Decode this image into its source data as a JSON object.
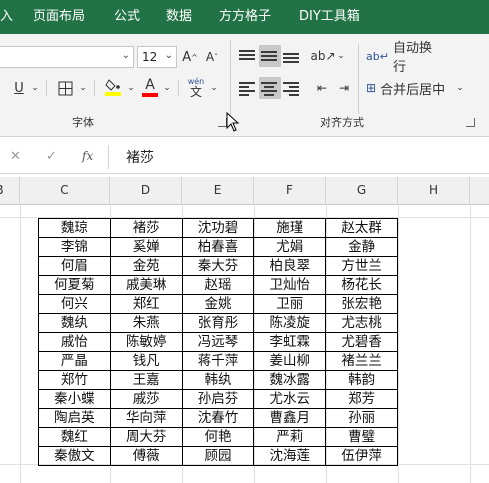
{
  "menu": {
    "tabs": [
      "入",
      "页面布局",
      "公式",
      "数据",
      "方方格子",
      "DIY工具箱"
    ]
  },
  "ribbon": {
    "font_size": "12",
    "font_group_label": "字体",
    "align_group_label": "对齐方式",
    "wrap_text_label": "自动换行",
    "merge_center_label": "合并后居中",
    "phonetic_top": "wén",
    "phonetic_bottom": "文"
  },
  "formula_bar": {
    "cancel_symbol": "✕",
    "enter_symbol": "✓",
    "fx_label": "fx",
    "content": "褚莎"
  },
  "columns": [
    "B",
    "C",
    "D",
    "E",
    "F",
    "G",
    "H"
  ],
  "table": {
    "rows": [
      [
        "魏琼",
        "褚莎",
        "沈功碧",
        "施瑾",
        "赵太群"
      ],
      [
        "李锦",
        "奚婵",
        "柏春喜",
        "尤娟",
        "金静"
      ],
      [
        "何眉",
        "金苑",
        "秦大芬",
        "柏良翠",
        "方世兰"
      ],
      [
        "何夏菊",
        "戚美琳",
        "赵瑶",
        "卫灿怡",
        "杨花长"
      ],
      [
        "何兴",
        "郑红",
        "金姚",
        "卫丽",
        "张宏艳"
      ],
      [
        "魏纨",
        "朱燕",
        "张育彤",
        "陈凌旋",
        "尤志桃"
      ],
      [
        "戚怡",
        "陈敏婷",
        "冯远琴",
        "李虹霖",
        "尤碧香"
      ],
      [
        "严晶",
        "钱凡",
        "蒋千萍",
        "姜山柳",
        "褚兰兰"
      ],
      [
        "郑竹",
        "王嘉",
        "韩纨",
        "魏冰露",
        "韩韵"
      ],
      [
        "秦小蝶",
        "戚莎",
        "孙启芬",
        "尤水云",
        "郑芳"
      ],
      [
        "陶启英",
        "华向萍",
        "沈春竹",
        "曹鑫月",
        "孙丽"
      ],
      [
        "魏红",
        "周大芬",
        "何艳",
        "严莉",
        "曹璧"
      ],
      [
        "秦傲文",
        "傅薇",
        "顾园",
        "沈海莲",
        "伍伊萍"
      ]
    ]
  },
  "colors": {
    "menu_bg": "#217346",
    "ribbon_bg": "#f3f3f3",
    "fill_color": "#ffff00",
    "font_color": "#ff0000"
  },
  "icons": [
    "font-size-increase-icon",
    "font-size-decrease-icon",
    "underline-icon",
    "border-icon",
    "fill-color-icon",
    "font-color-icon",
    "phonetic-icon",
    "align-top-icon",
    "align-middle-icon",
    "align-bottom-icon",
    "orientation-icon",
    "wrap-text-icon",
    "align-left-icon",
    "align-center-icon",
    "align-right-icon",
    "decrease-indent-icon",
    "increase-indent-icon",
    "merge-center-icon"
  ]
}
